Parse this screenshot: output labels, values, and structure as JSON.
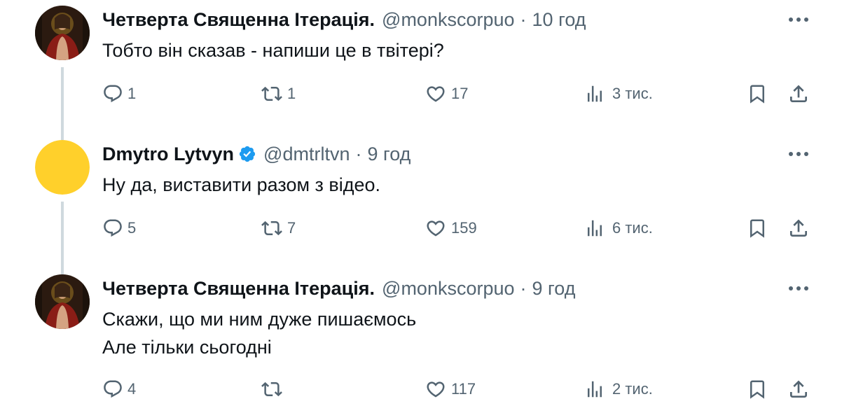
{
  "tweets": [
    {
      "name": "Четверта Священна Ітерація.",
      "handle": "@monkscorpuo",
      "separator": "·",
      "time": "10 год",
      "lines": [
        "Тобто він сказав - напиши це в твітері?"
      ],
      "replies": "1",
      "retweets": "1",
      "likes": "17",
      "views": "3 тис.",
      "avatar": "painting-avatar"
    },
    {
      "name": "Dmytro Lytvyn",
      "verified": true,
      "handle": "@dmtrltvn",
      "separator": "·",
      "time": "9 год",
      "lines": [
        "Ну да, виставити разом з відео."
      ],
      "replies": "5",
      "retweets": "7",
      "likes": "159",
      "views": "6 тис.",
      "avatar": "yellow-circle-avatar",
      "avatar_color": "#ffd02b"
    },
    {
      "name": "Четверта Священна Ітерація.",
      "handle": "@monkscorpuo",
      "separator": "·",
      "time": "9 год",
      "lines": [
        "Скажи, що ми ним дуже пишаємось",
        "Але тільки сьогодні"
      ],
      "replies": "4",
      "retweets": "",
      "likes": "117",
      "views": "2 тис.",
      "avatar": "painting-avatar"
    }
  ],
  "colors": {
    "text": "#0f1419",
    "secondary": "#536471",
    "verified": "#1d9bf0",
    "thread_line": "#cfd9de"
  }
}
